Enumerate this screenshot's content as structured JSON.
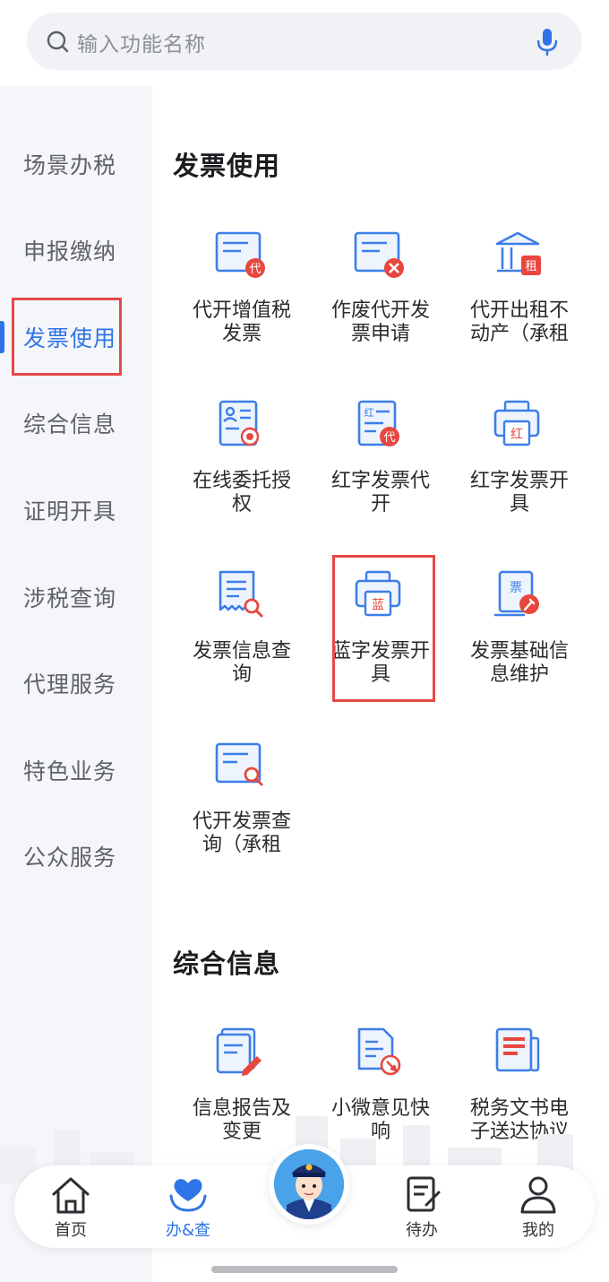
{
  "search": {
    "placeholder": "输入功能名称"
  },
  "sidebar": {
    "items": [
      {
        "label": "场景办税"
      },
      {
        "label": "申报缴纳"
      },
      {
        "label": "发票使用"
      },
      {
        "label": "综合信息"
      },
      {
        "label": "证明开具"
      },
      {
        "label": "涉税查询"
      },
      {
        "label": "代理服务"
      },
      {
        "label": "特色业务"
      },
      {
        "label": "公众服务"
      }
    ],
    "active_index": 2
  },
  "sections": [
    {
      "title": "发票使用",
      "tiles": [
        {
          "line1": "代开增值税",
          "line2": "发票",
          "icon": "invoice-dai-icon"
        },
        {
          "line1": "作废代开发",
          "line2": "票申请",
          "icon": "invoice-void-icon"
        },
        {
          "line1": "代开出租不",
          "line2": "动产（承租",
          "icon": "rent-building-icon"
        },
        {
          "line1": "在线委托授",
          "line2": "权",
          "icon": "authorize-icon"
        },
        {
          "line1": "红字发票代",
          "line2": "开",
          "icon": "red-invoice-dai-icon"
        },
        {
          "line1": "红字发票开",
          "line2": "具",
          "icon": "red-invoice-printer-icon"
        },
        {
          "line1": "发票信息查",
          "line2": "询",
          "icon": "invoice-search-icon"
        },
        {
          "line1": "蓝字发票开",
          "line2": "具",
          "icon": "blue-invoice-printer-icon"
        },
        {
          "line1": "发票基础信",
          "line2": "息维护",
          "icon": "invoice-maintain-icon"
        },
        {
          "line1": "代开发票查",
          "line2": "询（承租",
          "icon": "invoice-query-icon"
        }
      ]
    },
    {
      "title": "综合信息",
      "tiles": [
        {
          "line1": "信息报告及",
          "line2": "变更",
          "icon": "report-edit-icon"
        },
        {
          "line1": "小微意见快",
          "line2": "响",
          "icon": "feedback-icon"
        },
        {
          "line1": "税务文书电",
          "line2": "子送达协议",
          "icon": "document-icon"
        }
      ]
    }
  ],
  "icon_glyphs": {
    "dai": "代",
    "zu": "租",
    "hong": "红",
    "lan": "蓝",
    "piao": "票"
  },
  "tabbar": {
    "tabs": [
      {
        "label": "首页",
        "icon": "home-icon"
      },
      {
        "label": "办&查",
        "icon": "heart-hands-icon"
      },
      {
        "label": "待办",
        "icon": "todo-icon"
      },
      {
        "label": "我的",
        "icon": "user-icon"
      }
    ],
    "active_index": 1
  },
  "colors": {
    "accent": "#2f74e6",
    "highlight": "#e64848",
    "icon_red": "#e8473f"
  }
}
